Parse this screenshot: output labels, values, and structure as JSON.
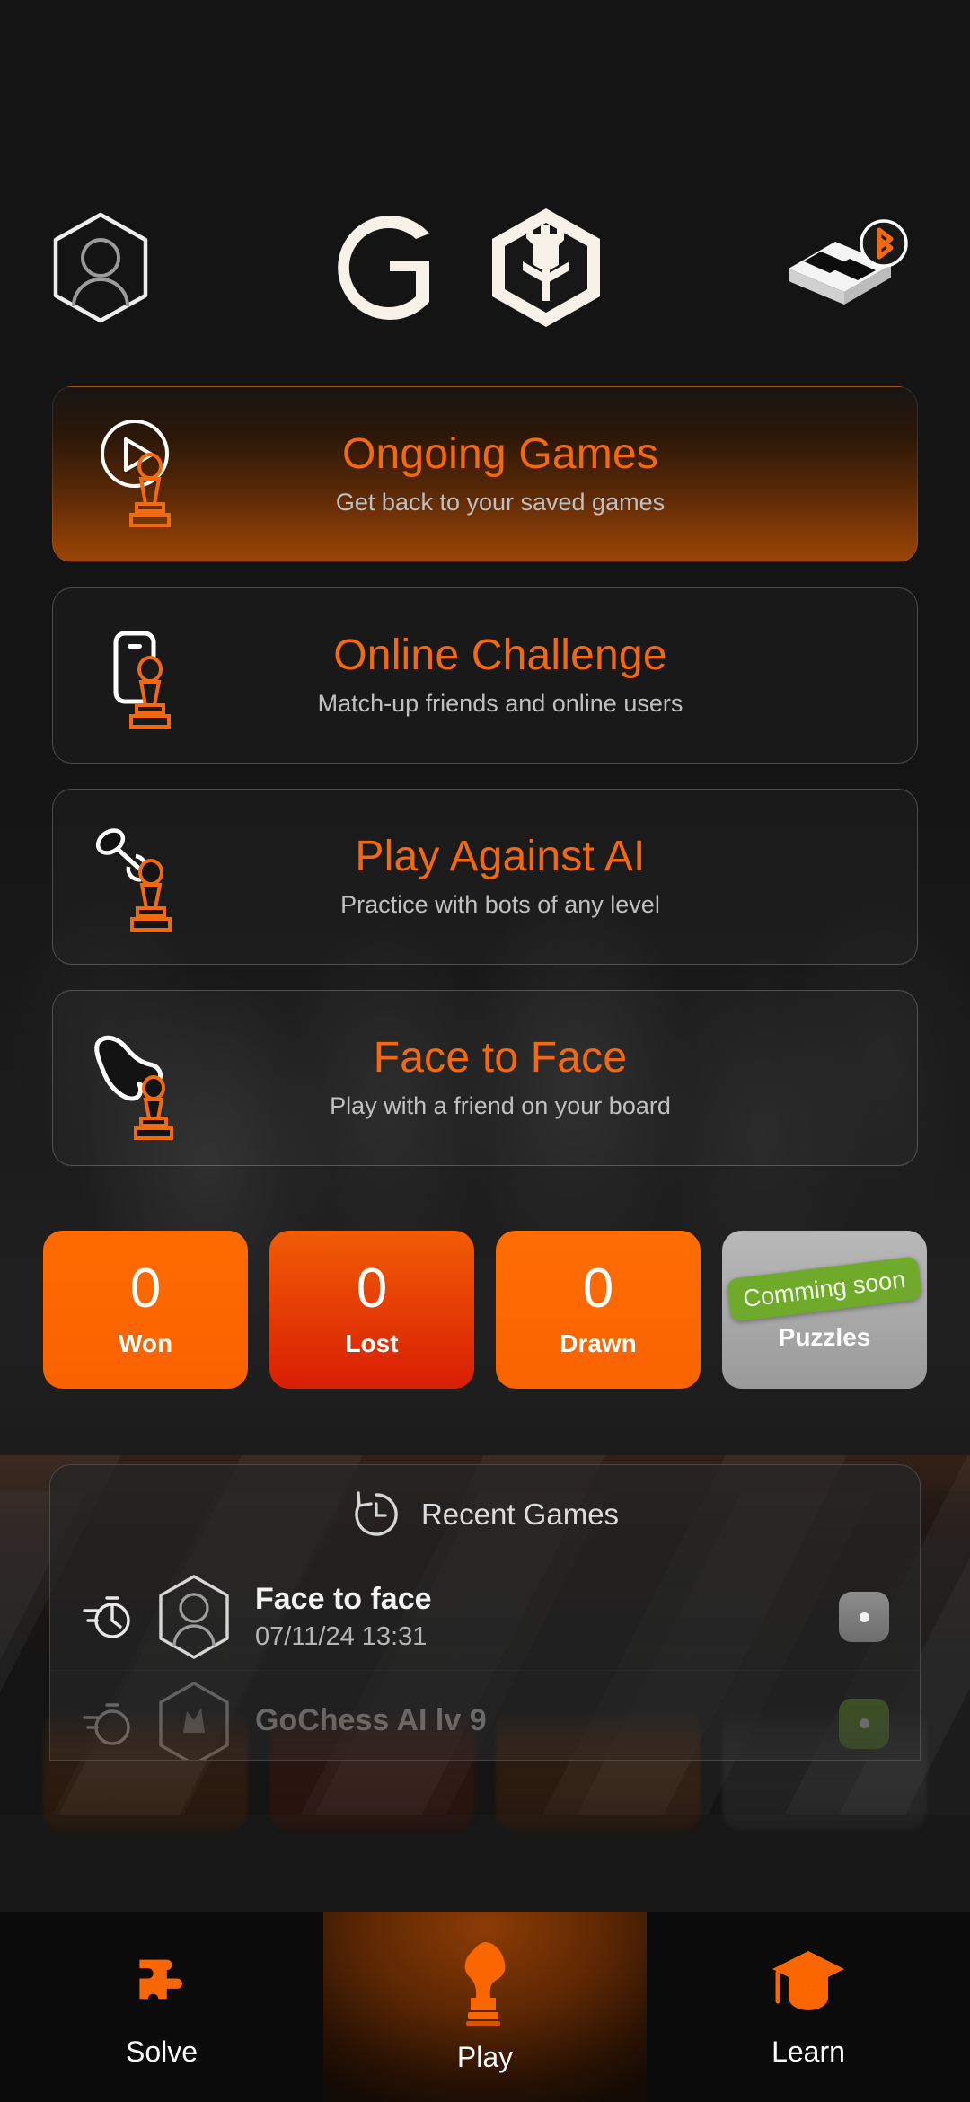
{
  "app": {
    "logo_text": "GO",
    "accent": "#F2690F",
    "orange": "#FF6A00",
    "red": "#D81E04",
    "green": "#6FAA2B",
    "gray": "#9A9A9A"
  },
  "header": {
    "profile_icon": "user-avatar-hexagon-icon",
    "logo_icon": "gochess-logo",
    "board_icon": "bluetooth-chessboard-icon"
  },
  "menu": {
    "cards": [
      {
        "title": "Ongoing Games",
        "subtitle": "Get back to your saved games",
        "icon": "play-pawn-icon",
        "highlighted": true
      },
      {
        "title": "Online Challenge",
        "subtitle": "Match-up friends and online users",
        "icon": "phone-pawn-icon",
        "highlighted": false
      },
      {
        "title": "Play Against AI",
        "subtitle": "Practice with bots of any level",
        "icon": "robot-arm-pawn-icon",
        "highlighted": false
      },
      {
        "title": "Face to Face",
        "subtitle": "Play with a friend on your board",
        "icon": "hand-pawn-icon",
        "highlighted": false
      }
    ]
  },
  "stats": {
    "tiles": [
      {
        "value": "0",
        "label": "Won",
        "kind": "won"
      },
      {
        "value": "0",
        "label": "Lost",
        "kind": "lost"
      },
      {
        "value": "0",
        "label": "Drawn",
        "kind": "drawn"
      },
      {
        "badge": "Comming soon",
        "label": "Puzzles",
        "kind": "soon"
      }
    ]
  },
  "recent": {
    "heading": "Recent Games",
    "heading_icon": "history-clock-icon",
    "rows": [
      {
        "title": "Face to face",
        "date": "07/11/24 13:31",
        "left_icon": "stopwatch-icon",
        "avatar_icon": "user-avatar-hexagon-icon",
        "badge": "white-dot"
      },
      {
        "title": "GoChess AI lv 9",
        "date": "",
        "left_icon": "stopwatch-icon",
        "avatar_icon": "robot-avatar-hexagon-icon",
        "badge": "green-dot"
      }
    ]
  },
  "bottom_nav": {
    "items": [
      {
        "label": "Solve",
        "icon": "puzzle-piece-icon",
        "active": false
      },
      {
        "label": "Play",
        "icon": "knight-chess-icon",
        "active": true
      },
      {
        "label": "Learn",
        "icon": "graduation-cap-icon",
        "active": false
      }
    ]
  }
}
